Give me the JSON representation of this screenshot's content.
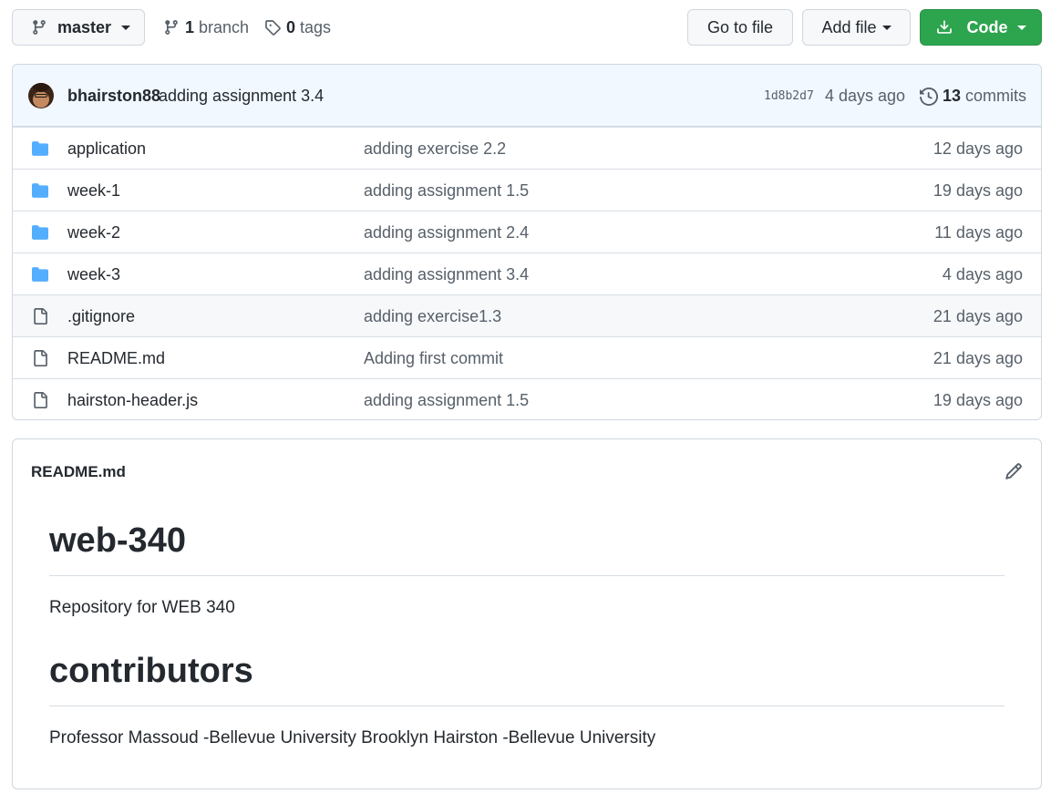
{
  "toolbar": {
    "branch_select": "master",
    "branch_count": "1",
    "branch_label": "branch",
    "tag_count": "0",
    "tag_label": "tags",
    "goto_file": "Go to file",
    "add_file": "Add file",
    "code": "Code"
  },
  "commit": {
    "author": "bhairston88",
    "message": "adding assignment 3.4",
    "sha": "1d8b2d7",
    "age": "4 days ago",
    "count": "13",
    "count_label": "commits"
  },
  "files": [
    {
      "type": "folder",
      "name": "application",
      "message": "adding exercise 2.2",
      "age": "12 days ago"
    },
    {
      "type": "folder",
      "name": "week-1",
      "message": "adding assignment 1.5",
      "age": "19 days ago"
    },
    {
      "type": "folder",
      "name": "week-2",
      "message": "adding assignment 2.4",
      "age": "11 days ago"
    },
    {
      "type": "folder",
      "name": "week-3",
      "message": "adding assignment 3.4",
      "age": "4 days ago"
    },
    {
      "type": "file",
      "name": ".gitignore",
      "message": "adding exercise1.3",
      "age": "21 days ago"
    },
    {
      "type": "file",
      "name": "README.md",
      "message": "Adding first commit",
      "age": "21 days ago"
    },
    {
      "type": "file",
      "name": "hairston-header.js",
      "message": "adding assignment 1.5",
      "age": "19 days ago"
    }
  ],
  "readme": {
    "filename": "README.md",
    "title": "web-340",
    "description": "Repository for WEB 340",
    "contributors_heading": "contributors",
    "contributors_text": "Professor Massoud -Bellevue University Brooklyn Hairston -Bellevue University"
  },
  "colors": {
    "code_button": "#2da44e",
    "folder_icon": "#54aeff",
    "commit_bar": "#f1f8ff"
  }
}
